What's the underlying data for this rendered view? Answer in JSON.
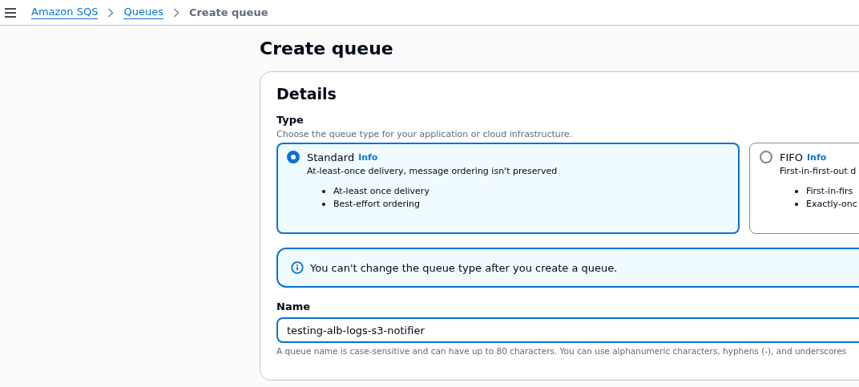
{
  "breadcrumbs": [
    {
      "label": "Amazon SQS",
      "kind": "link"
    },
    {
      "label": "Queues",
      "kind": "link"
    },
    {
      "label": "Create queue",
      "kind": "current"
    }
  ],
  "page_title": "Create queue",
  "details": {
    "title": "Details",
    "type": {
      "label": "Type",
      "description": "Choose the queue type for your application or cloud infrastructure.",
      "options": [
        {
          "name": "Standard",
          "info": "Info",
          "selected": true,
          "description": "At-least-once delivery, message ordering isn't preserved",
          "bullets": [
            "At-least once delivery",
            "Best-effort ordering"
          ]
        },
        {
          "name": "FIFO",
          "info": "Info",
          "selected": false,
          "description": "First-in-first-out d",
          "bullets": [
            "First-in-firs",
            "Exactly-onc"
          ]
        }
      ]
    },
    "alert": "You can't change the queue type after you create a queue.",
    "name": {
      "label": "Name",
      "value": "testing-alb-logs-s3-notifier",
      "hint": "A queue name is case-sensitive and can have up to 80 characters. You can use alphanumeric characters, hyphens (-), and underscores"
    }
  }
}
